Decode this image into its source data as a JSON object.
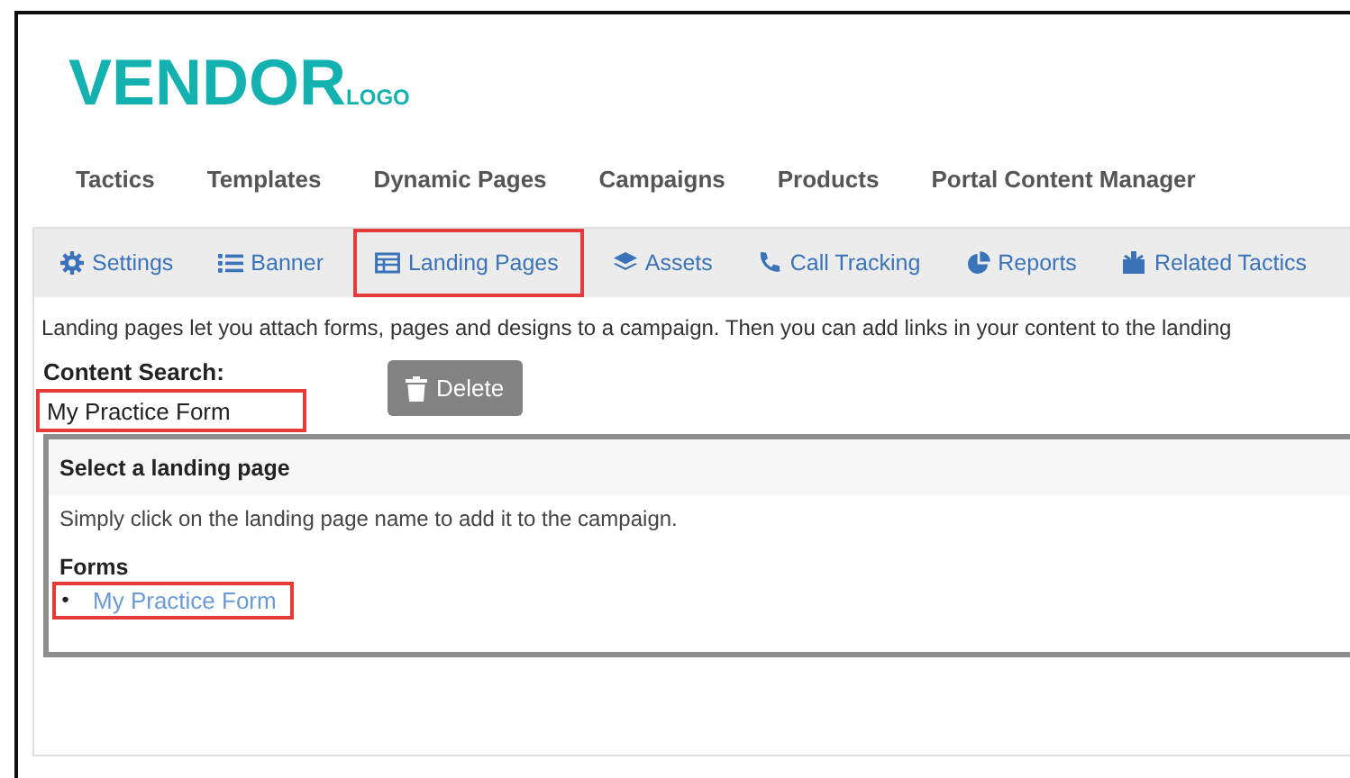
{
  "logo": {
    "main": "VENDOR",
    "sub": "LOGO"
  },
  "nav": [
    "Tactics",
    "Templates",
    "Dynamic Pages",
    "Campaigns",
    "Products",
    "Portal Content Manager"
  ],
  "tabs": [
    {
      "label": "Settings",
      "highlighted": false
    },
    {
      "label": "Banner",
      "highlighted": false
    },
    {
      "label": "Landing Pages",
      "highlighted": true
    },
    {
      "label": "Assets",
      "highlighted": false
    },
    {
      "label": "Call Tracking",
      "highlighted": false
    },
    {
      "label": "Reports",
      "highlighted": false
    },
    {
      "label": "Related Tactics",
      "highlighted": false
    }
  ],
  "description": "Landing pages let you attach forms, pages and designs to a campaign. Then you can add links in your content to the landing",
  "search": {
    "label": "Content Search:",
    "value": "My Practice Form",
    "highlighted": true
  },
  "delete_button": "Delete",
  "panel": {
    "title": "Select a landing page",
    "hint": "Simply click on the landing page name to add it to the campaign.",
    "section": "Forms",
    "items": [
      {
        "bullet": "•",
        "label": "My Practice Form",
        "highlighted": true
      }
    ]
  }
}
